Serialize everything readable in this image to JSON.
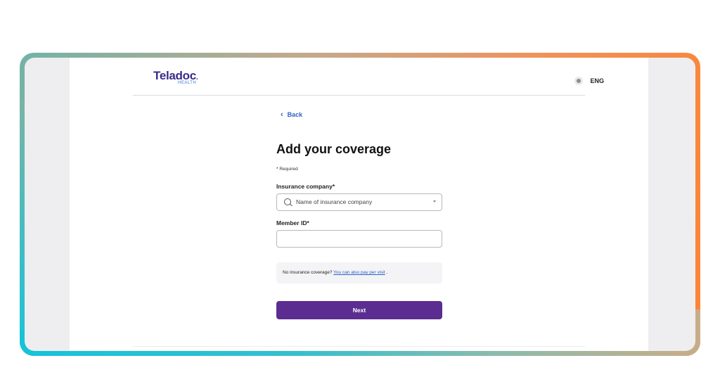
{
  "brand": {
    "name": "Teladoc",
    "sub": "HEALTH",
    "dot": "."
  },
  "header": {
    "language": "ENG"
  },
  "nav": {
    "back_label": "Back"
  },
  "form": {
    "title": "Add your coverage",
    "required_note": "Required",
    "required_star": "*",
    "insurance_label": "Insurance company*",
    "insurance_placeholder": "Name of insurance company",
    "member_label": "Member ID*",
    "member_value": ""
  },
  "notice": {
    "text": "No insurance coverage?",
    "link": "You can also pay per visit",
    "suffix": "."
  },
  "actions": {
    "next_label": "Next"
  },
  "colors": {
    "accent": "#5b2d91",
    "link": "#2d62c4",
    "brand": "#3b2a8a"
  },
  "icons": {
    "back": "chevron-left-icon",
    "search": "search-icon",
    "dropdown": "caret-down-icon",
    "language": "globe-icon"
  }
}
